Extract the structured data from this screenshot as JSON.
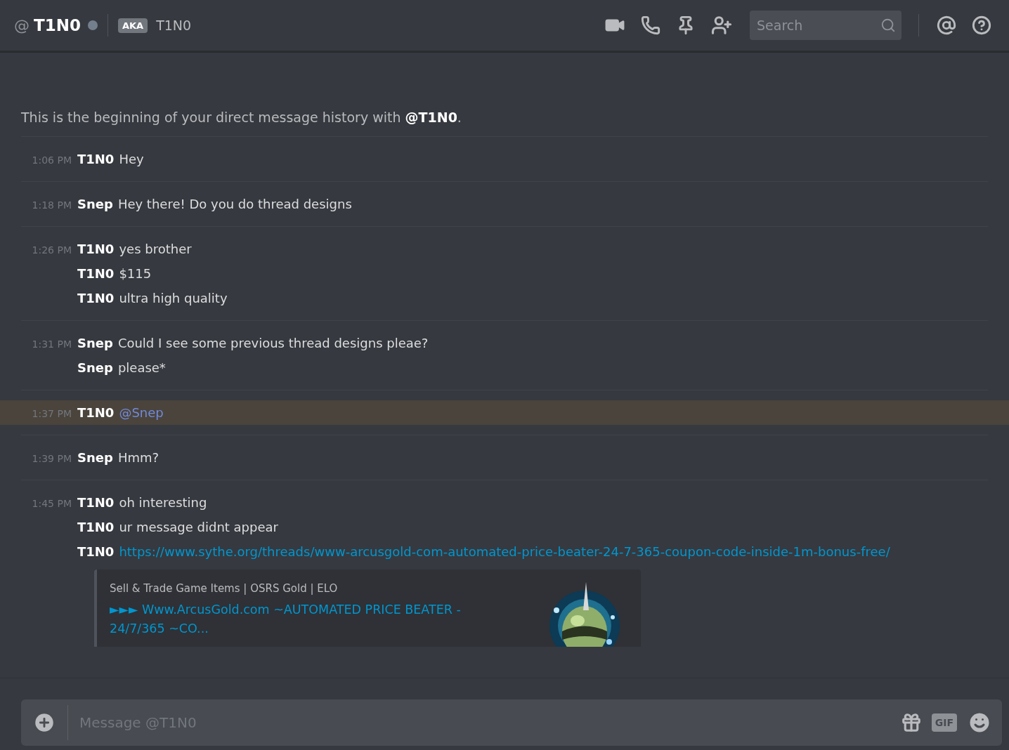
{
  "header": {
    "at_sign": "@",
    "title": "T1N0",
    "online": false,
    "aka_badge": "AKA",
    "aka_name": "T1N0",
    "search": {
      "placeholder": "Search"
    }
  },
  "intro": "This is the beginning of your direct message history with **@T1N0**.",
  "groups": [
    {
      "time": "1:06 PM",
      "mentioned": false,
      "lines": [
        {
          "author": "T1N0",
          "kind": "text",
          "text": "Hey"
        }
      ]
    },
    {
      "time": "1:18 PM",
      "mentioned": false,
      "lines": [
        {
          "author": "Snep",
          "kind": "text",
          "text": "Hey there! Do you do thread designs"
        }
      ]
    },
    {
      "time": "1:26 PM",
      "mentioned": false,
      "lines": [
        {
          "author": "T1N0",
          "kind": "text",
          "text": "yes brother"
        },
        {
          "author": "T1N0",
          "kind": "text",
          "text": "$115"
        },
        {
          "author": "T1N0",
          "kind": "text",
          "text": "ultra high quality"
        }
      ]
    },
    {
      "time": "1:31 PM",
      "mentioned": false,
      "lines": [
        {
          "author": "Snep",
          "kind": "text",
          "text": "Could I see some previous thread designs pleae?"
        },
        {
          "author": "Snep",
          "kind": "text",
          "text": "please*"
        }
      ]
    },
    {
      "time": "1:37 PM",
      "mentioned": true,
      "lines": [
        {
          "author": "T1N0",
          "kind": "mention",
          "text": "@Snep"
        }
      ]
    },
    {
      "time": "1:39 PM",
      "mentioned": false,
      "lines": [
        {
          "author": "Snep",
          "kind": "text",
          "text": "Hmm?"
        }
      ]
    },
    {
      "time": "1:45 PM",
      "mentioned": false,
      "lines": [
        {
          "author": "T1N0",
          "kind": "text",
          "text": "oh interesting"
        },
        {
          "author": "T1N0",
          "kind": "text",
          "text": "ur message didnt appear"
        },
        {
          "author": "T1N0",
          "kind": "link",
          "text": "https://www.sythe.org/threads/www-arcusgold-com-automated-price-beater-24-7-365-coupon-code-inside-1m-bonus-free/"
        }
      ],
      "embed": {
        "provider": "Sell & Trade Game Items | OSRS Gold | ELO",
        "title": "►►► Www.ArcusGold.com ~AUTOMATED PRICE BEATER - 24/7/365 ~CO...",
        "kind": "picture"
      }
    }
  ],
  "composer": {
    "placeholder": "Message @T1N0",
    "gif": "GIF"
  }
}
